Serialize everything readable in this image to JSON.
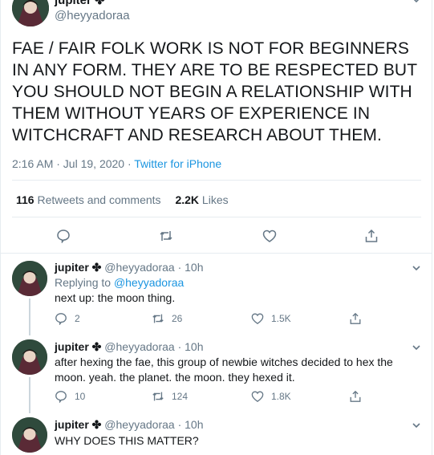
{
  "main": {
    "name": "jupiter ✤",
    "handle": "@heyyadoraa",
    "text": "FAE / FAIR FOLK WORK IS NOT FOR BEGINNERS IN ANY FORM. THEY ARE TO BE RESPECTED BUT YOU SHOULD NOT BEGIN A RELATIONSHIP WITH THEM WITHOUT YEARS OF EXPERIENCE IN WITCHCRAFT AND RESEARCH ABOUT THEM.",
    "time": "2:16 AM · Jul 19, 2020 · ",
    "source": "Twitter for iPhone",
    "retweets_count": "116",
    "retweets_label": "Retweets and comments",
    "likes_count": "2.2K",
    "likes_label": "Likes"
  },
  "replies": [
    {
      "name": "jupiter ✤",
      "handle": "@heyyadoraa",
      "time": " · 10h",
      "replying_label": "Replying to ",
      "replying_to": "@heyyadoraa",
      "text": "next up: the moon thing.",
      "comments": "2",
      "retweets": "26",
      "likes": "1.5K"
    },
    {
      "name": "jupiter ✤",
      "handle": "@heyyadoraa",
      "time": " · 10h",
      "text": "after hexing the fae, this group of newbie witches decided to hex the moon. yeah. the planet. the moon. they hexed it.",
      "comments": "10",
      "retweets": "124",
      "likes": "1.8K"
    },
    {
      "name": "jupiter ✤",
      "handle": "@heyyadoraa",
      "time": " · 10h",
      "text": "WHY DOES THIS MATTER?"
    }
  ],
  "colors": {
    "link": "#1b95e0",
    "muted": "#657786",
    "divider": "#e6ecf0",
    "thread": "#ccd6dd"
  },
  "icons": [
    "chevron-down-icon",
    "reply-icon",
    "retweet-icon",
    "like-icon",
    "share-icon"
  ]
}
